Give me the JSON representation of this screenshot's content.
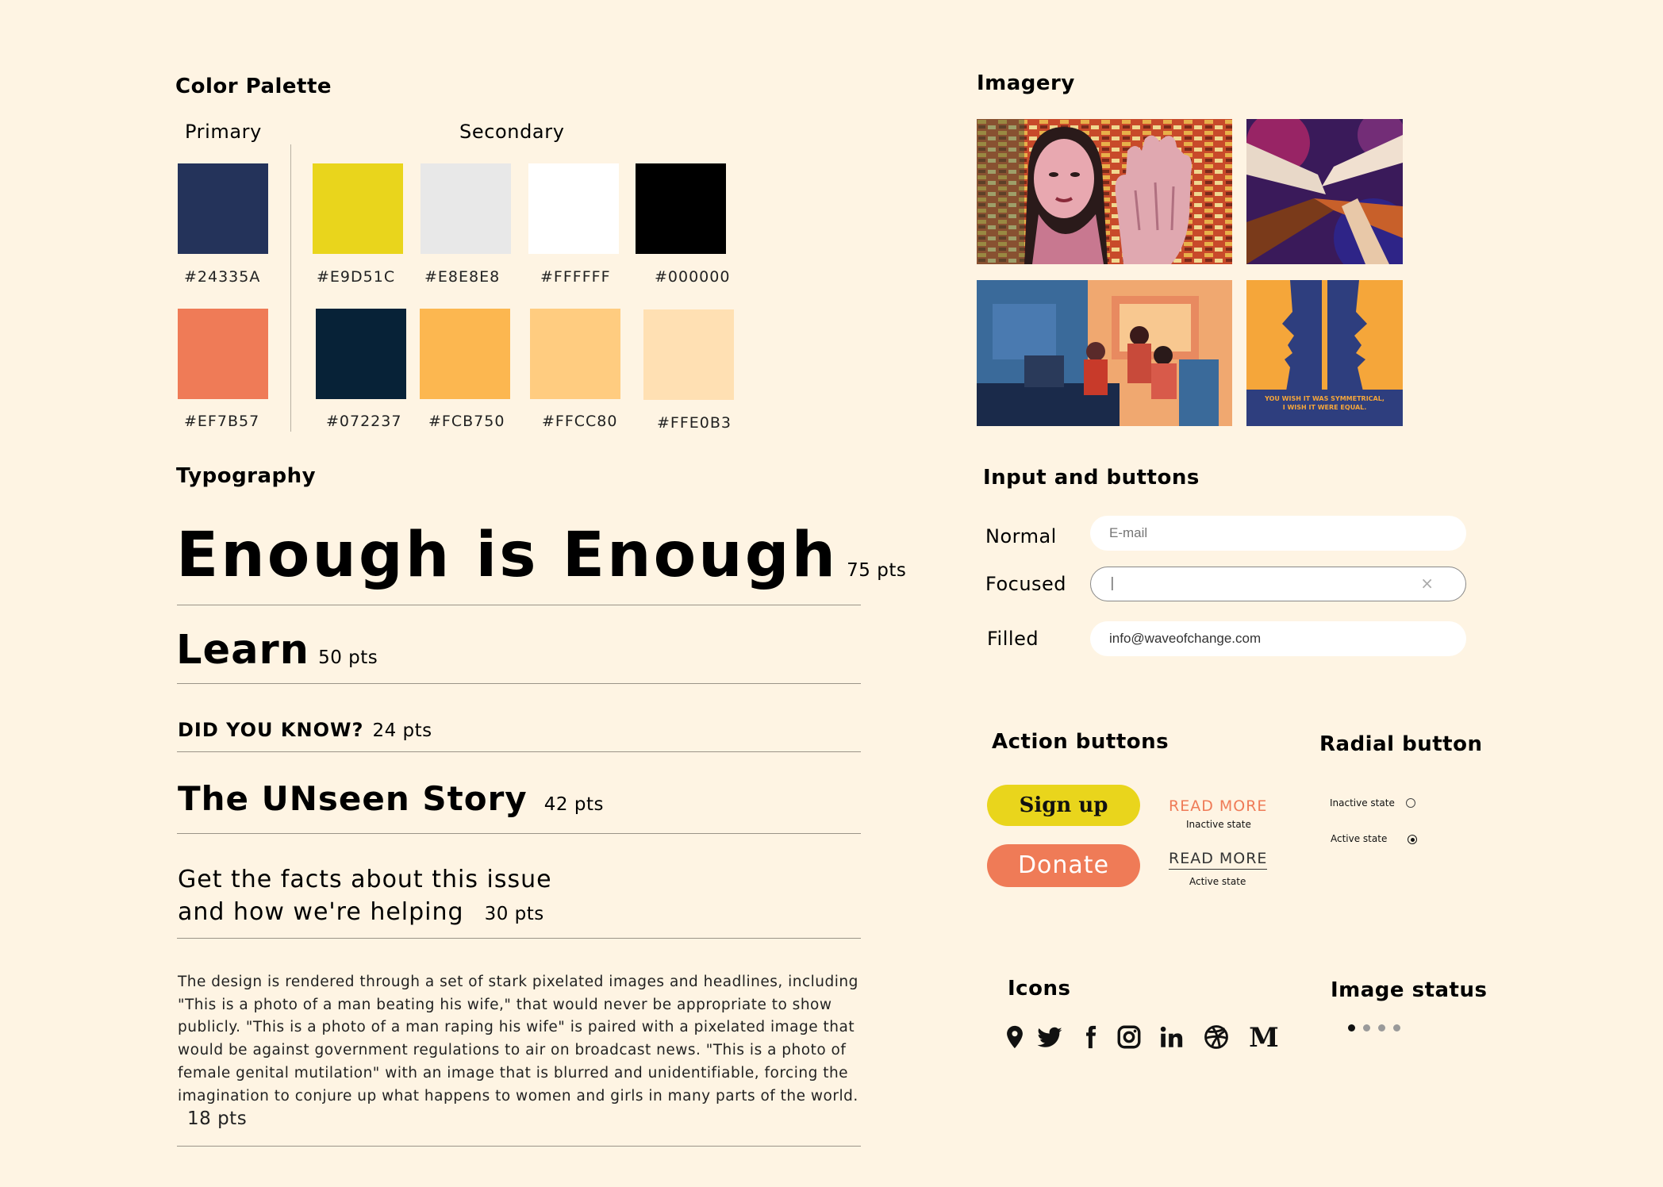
{
  "palette": {
    "title": "Color Palette",
    "primary_label": "Primary",
    "secondary_label": "Secondary",
    "colors": [
      {
        "hex": "#24335A"
      },
      {
        "hex": "#E9D51C"
      },
      {
        "hex": "#E8E8E8"
      },
      {
        "hex": "#FFFFFF"
      },
      {
        "hex": "#000000"
      },
      {
        "hex": "#EF7B57"
      },
      {
        "hex": "#072237"
      },
      {
        "hex": "#FCB750"
      },
      {
        "hex": "#FFCC80"
      },
      {
        "hex": "#FFE0B3"
      }
    ]
  },
  "imagery": {
    "title": "Imagery",
    "poster_text_1": "YOU WISH IT WAS SYMMETRICAL,",
    "poster_text_2": "I WISH IT WERE EQUAL."
  },
  "typography": {
    "title": "Typography",
    "h1": "Enough is Enough",
    "h1_pts": "75 pts",
    "h2": "Learn",
    "h2_pts": "50 pts",
    "h3": "DID YOU KNOW?",
    "h3_pts": "24 pts",
    "h4": "The UNseen Story",
    "h4_pts": "42 pts",
    "sub_line1": "Get the facts about this issue",
    "sub_line2": "and how we're helping",
    "sub_pts": "30 pts",
    "body": "The design is rendered through a set of stark pixelated images and headlines, including \"This is a photo of a man beating his wife,\" that would never be appropriate to show publicly. \"This is a photo of a man raping his wife\" is paired with a pixelated image that would be against government regulations to air on broadcast news. \"This is a photo of female genital mutilation\" with an image that is blurred and unidentifiable, forcing the imagination to conjure up what happens to women and girls in many parts of the world.",
    "body_pts": "18 pts"
  },
  "inputs": {
    "title": "Input and buttons",
    "normal_label": "Normal",
    "normal_placeholder": "E-mail",
    "focused_label": "Focused",
    "focused_value": "|",
    "focused_clear": "×",
    "filled_label": "Filled",
    "filled_value": "info@waveofchange.com"
  },
  "action": {
    "title": "Action buttons",
    "signup": "Sign up",
    "donate": "Donate",
    "read_more": "READ MORE",
    "inactive_state": "Inactive state",
    "active_state": "Active state"
  },
  "radial": {
    "title": "Radial button",
    "inactive": "Inactive state",
    "active": "Active state"
  },
  "icons": {
    "title": "Icons",
    "items": [
      "location-pin-icon",
      "twitter-icon",
      "facebook-icon",
      "instagram-icon",
      "linkedin-icon",
      "dribbble-icon",
      "medium-icon"
    ]
  },
  "image_status": {
    "title": "Image status",
    "total": 4,
    "active_index": 0
  }
}
